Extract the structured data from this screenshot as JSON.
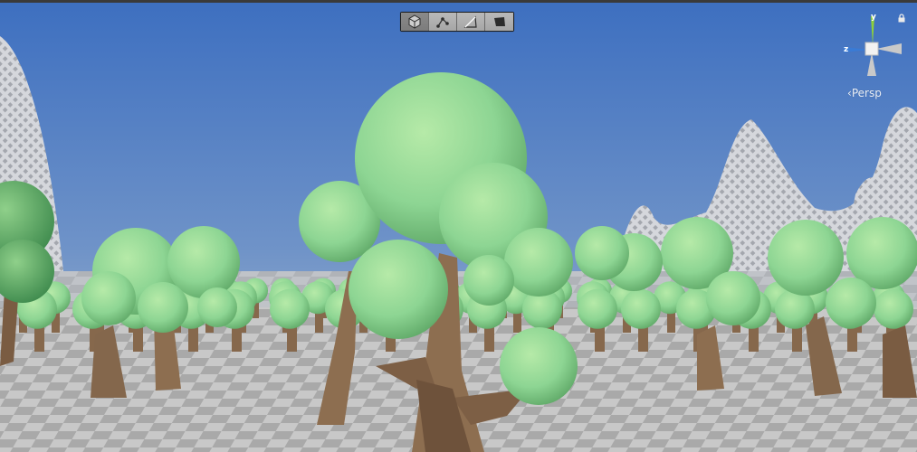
{
  "toolbar": {
    "tools": [
      {
        "id": "mesh",
        "icon": "cube-icon",
        "active": true
      },
      {
        "id": "vertex",
        "icon": "vertex-edge-icon",
        "active": false
      },
      {
        "id": "edge",
        "icon": "triangle-edge-icon",
        "active": false
      },
      {
        "id": "face",
        "icon": "face-icon",
        "active": false
      }
    ]
  },
  "gizmo": {
    "y_label": "y",
    "z_label": "z",
    "projection_label": "Persp",
    "lock_icon": "lock-icon"
  },
  "colors": {
    "sky_top": "#3d6fc0",
    "sky_bottom": "#aab8cc",
    "foliage": "#8fd694",
    "trunk": "#8d6e50",
    "ground_light": "#c9c9c9",
    "ground_dark": "#a8a8a8",
    "axis_y": "#8ed13a",
    "axis_z": "#3a7bd5"
  }
}
